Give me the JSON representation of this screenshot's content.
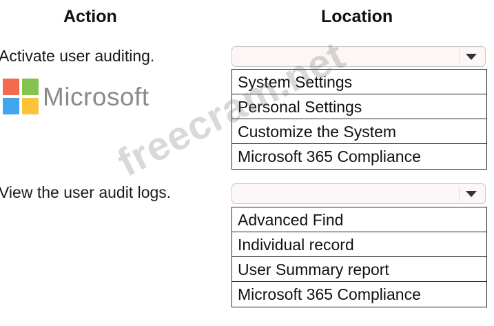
{
  "headers": {
    "action": "Action",
    "location": "Location"
  },
  "rows": [
    {
      "action": "Activate user auditing.",
      "selected": "",
      "options": [
        "System Settings",
        "Personal Settings",
        "Customize the System",
        "Microsoft 365 Compliance"
      ]
    },
    {
      "action": "View the user audit logs.",
      "selected": "",
      "options": [
        "Advanced Find",
        "Individual record",
        "User Summary report",
        "Microsoft 365 Compliance"
      ]
    }
  ],
  "logo": {
    "text": "Microsoft"
  },
  "watermark": "freecram.net"
}
